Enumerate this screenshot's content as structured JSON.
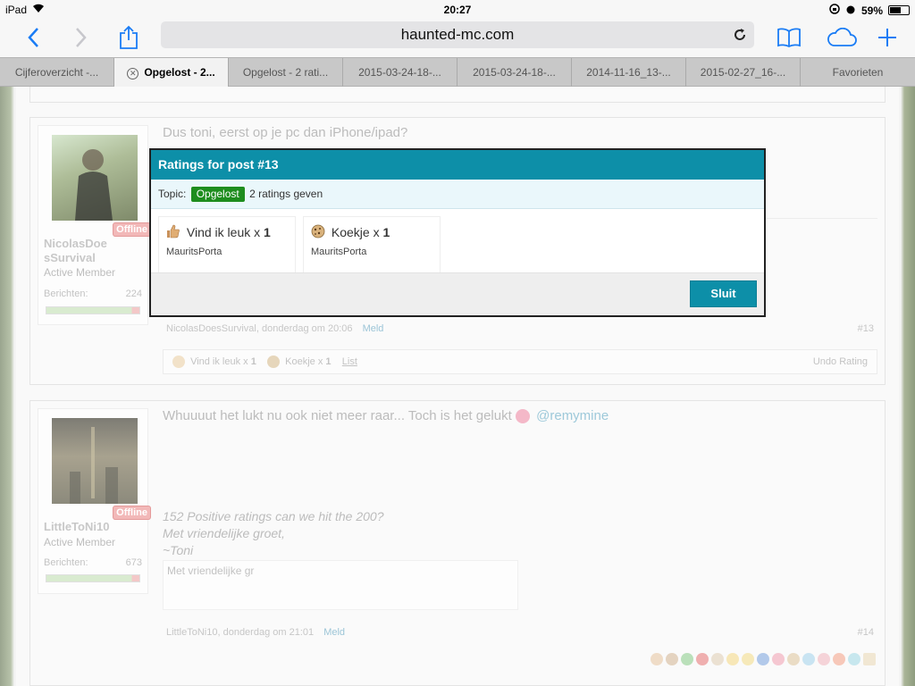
{
  "status_bar": {
    "device": "iPad",
    "time": "20:27",
    "battery_text": "59%",
    "battery_level": 0.59
  },
  "browser": {
    "url": "haunted-mc.com",
    "tabs": [
      {
        "label": "Cijferoverzicht -...",
        "active": false
      },
      {
        "label": "Opgelost - 2...",
        "active": true
      },
      {
        "label": "Opgelost - 2 rati...",
        "active": false
      },
      {
        "label": "2015-03-24-18-...",
        "active": false
      },
      {
        "label": "2015-03-24-18-...",
        "active": false
      },
      {
        "label": "2014-11-16_13-...",
        "active": false
      },
      {
        "label": "2015-02-27_16-...",
        "active": false
      },
      {
        "label": "Favorieten",
        "active": false
      }
    ]
  },
  "post13": {
    "message": "Dus toni, eerst op je pc dan iPhone/ipad?",
    "author": "NicolasDoesSurvival",
    "author_line1": "NicolasDoe",
    "author_line2": "sSurvival",
    "rank": "Active Member",
    "posts_label": "Berichten:",
    "posts_count": "224",
    "status": "Offline",
    "meta_text": "NicolasDoesSurvival, donderdag om 20:06",
    "report_link": "Meld",
    "number": "#13",
    "ratings_like": "Vind ik leuk x",
    "ratings_like_count": "1",
    "ratings_cookie": "Koekje x",
    "ratings_cookie_count": "1",
    "list_link": "List",
    "undo": "Undo Rating"
  },
  "post14": {
    "message": "Whuuuut het lukt nu ook niet meer raar... Toch is het gelukt",
    "mention": "@remymine",
    "author": "LittleToNi10",
    "rank": "Active Member",
    "posts_label": "Berichten:",
    "posts_count": "673",
    "status": "Offline",
    "signature_line1": "152 Positive ratings can we hit the 200?",
    "signature_line2": "Met vriendelijke groet,",
    "signature_line3": "~Toni",
    "quote_text": "Met vriendelijke gr",
    "meta_text": "LittleToNi10, donderdag om 21:01",
    "report_link": "Meld",
    "number": "#14"
  },
  "modal": {
    "title": "Ratings for post #13",
    "topic_label": "Topic:",
    "topic_tag": "Opgelost",
    "topic_text": "2 ratings geven",
    "ratings": [
      {
        "label": "Vind ik leuk x",
        "count": "1",
        "user": "MauritsPorta",
        "icon": "thumbs-up-icon"
      },
      {
        "label": "Koekje x",
        "count": "1",
        "user": "MauritsPorta",
        "icon": "cookie-icon"
      }
    ],
    "close_label": "Sluit"
  }
}
